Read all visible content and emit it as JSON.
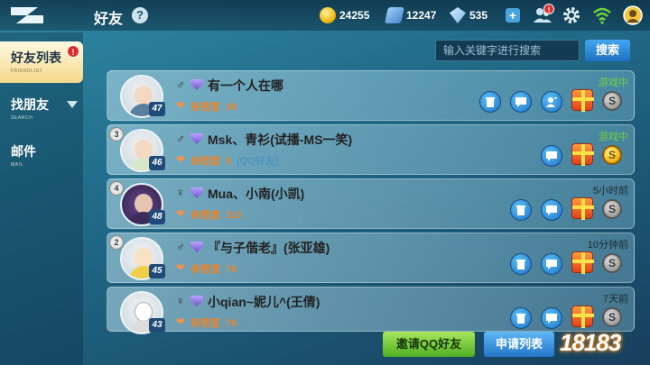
{
  "header": {
    "title": "好友",
    "help_label": "?",
    "currencies": [
      {
        "icon": "coin-icon",
        "value": "24255"
      },
      {
        "icon": "card-icon",
        "value": "12247"
      },
      {
        "icon": "diamond-icon",
        "value": "535"
      }
    ],
    "plus_label": "+",
    "notification_badge": "!"
  },
  "sidebar": {
    "items": [
      {
        "label": "好友列表",
        "sub": "FRIENDLIST",
        "badge": "!"
      },
      {
        "label": "找朋友",
        "sub": "SEARCH"
      },
      {
        "label": "邮件",
        "sub": "MAIL"
      }
    ]
  },
  "search": {
    "placeholder": "输入关键字进行搜索",
    "button_label": "搜索"
  },
  "friends": [
    {
      "gender": "♂",
      "name": "有一个人在哪",
      "level": "47",
      "intimacy_label": "亲密度",
      "intimacy": "38",
      "status": "游戏中",
      "status_type": "ingame",
      "rank": ""
    },
    {
      "gender": "♂",
      "name": "Msk、青衫(试播-MS一笑)",
      "level": "46",
      "intimacy_label": "亲密度",
      "intimacy": "0",
      "qq_tag": "(QQ好友)",
      "status": "游戏中",
      "status_type": "ingame",
      "rank": "3"
    },
    {
      "gender": "♀",
      "name": "Mua、小南(小凯)",
      "level": "48",
      "intimacy_label": "亲密度",
      "intimacy": "110",
      "status": "5小时前",
      "status_type": "offline",
      "rank": "4"
    },
    {
      "gender": "♂",
      "name": "『与子偕老』(张亚雄)",
      "level": "45",
      "intimacy_label": "亲密度",
      "intimacy": "76",
      "status": "10分钟前",
      "status_type": "offline",
      "rank": "2"
    },
    {
      "gender": "♀",
      "name": "小qian~妮儿^(王倩)",
      "level": "43",
      "intimacy_label": "亲密度",
      "intimacy": "76",
      "status": "7天前",
      "status_type": "offline",
      "rank": ""
    }
  ],
  "footer": {
    "invite_label": "邀请QQ好友",
    "apply_label": "申请列表"
  },
  "watermark": "18183",
  "colors": {
    "ingame": "#6fd23b",
    "intimacy": "#e6862f",
    "accent": "#2476c8"
  }
}
